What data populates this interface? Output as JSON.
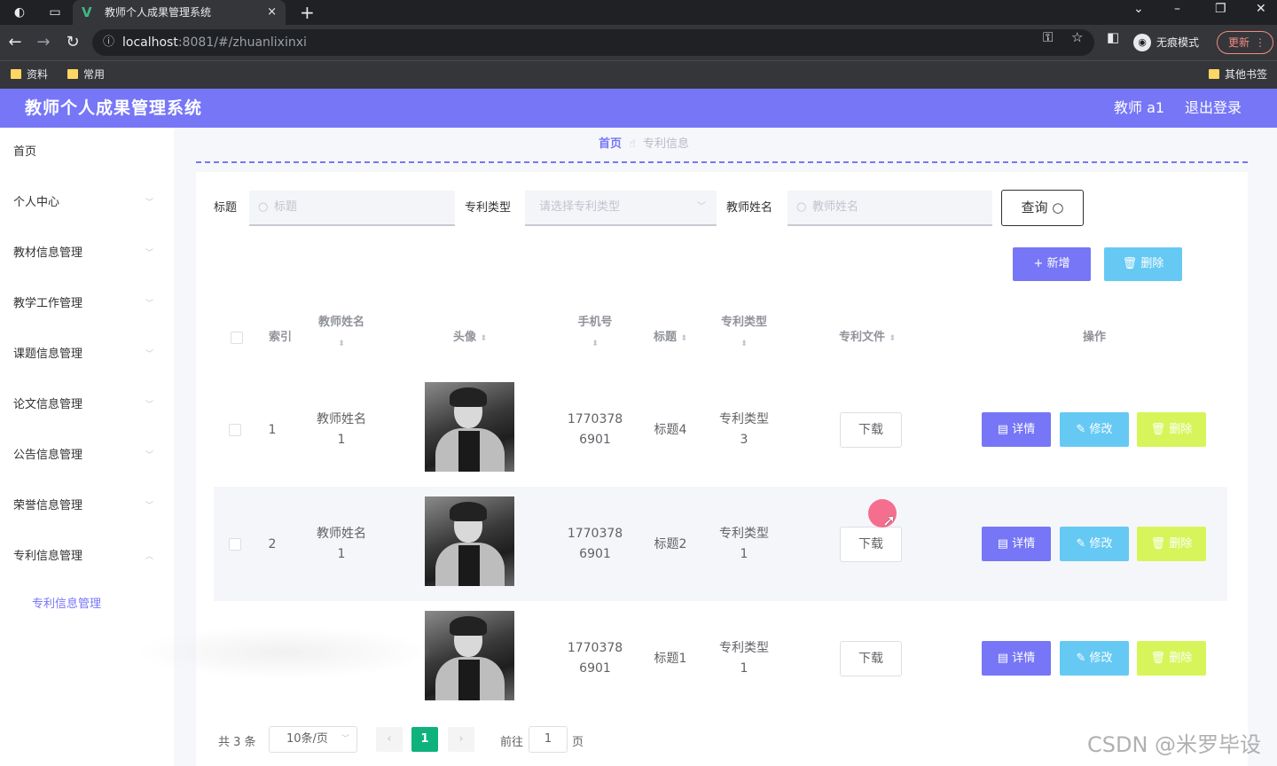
{
  "browser": {
    "tab_title": "教师个人成果管理系统",
    "tab_close": "×",
    "new_tab": "+",
    "url_host": "localhost",
    "url_path": ":8081/#/zhuanlixinxi",
    "incognito_label": "无痕模式",
    "update_label": "更新",
    "bookmarks": [
      "资料",
      "常用"
    ],
    "other_bookmarks": "其他书签"
  },
  "header": {
    "title": "教师个人成果管理系统",
    "user": "教师 a1",
    "logout": "退出登录"
  },
  "sidebar": {
    "items": [
      "首页",
      "个人中心",
      "教材信息管理",
      "教学工作管理",
      "课题信息管理",
      "论文信息管理",
      "公告信息管理",
      "荣誉信息管理",
      "专利信息管理"
    ],
    "sub_item": "专利信息管理"
  },
  "breadcrumb": {
    "home": "首页",
    "current": "专利信息"
  },
  "search": {
    "title_label": "标题",
    "title_placeholder": "标题",
    "type_label": "专利类型",
    "type_placeholder": "请选择专利类型",
    "teacher_label": "教师姓名",
    "teacher_placeholder": "教师姓名",
    "query_label": "查询"
  },
  "toolbar": {
    "add_label": "新增",
    "delete_label": "删除"
  },
  "table": {
    "headers": {
      "index": "索引",
      "teacher_name": "教师姓名",
      "avatar": "头像",
      "phone": "手机号",
      "title": "标题",
      "patent_type": "专利类型",
      "patent_file": "专利文件",
      "actions": "操作"
    },
    "rows": [
      {
        "index": "1",
        "name_a": "教师姓名",
        "name_b": "1",
        "phone_a": "1770378",
        "phone_b": "6901",
        "title": "标题4",
        "type_a": "专利类型",
        "type_b": "3"
      },
      {
        "index": "2",
        "name_a": "教师姓名",
        "name_b": "1",
        "phone_a": "1770378",
        "phone_b": "6901",
        "title": "标题2",
        "type_a": "专利类型",
        "type_b": "1"
      },
      {
        "index": "",
        "name_a": "",
        "name_b": "",
        "phone_a": "1770378",
        "phone_b": "6901",
        "title": "标题1",
        "type_a": "专利类型",
        "type_b": "1"
      }
    ],
    "download_label": "下载",
    "detail_label": "详情",
    "edit_label": "修改",
    "delete_label": "删除"
  },
  "pagination": {
    "total": "共 3 条",
    "page_size": "10条/页",
    "current_page": "1",
    "goto_prefix": "前往",
    "goto_value": "1",
    "goto_suffix": "页"
  },
  "watermark": "CSDN @米罗毕设",
  "colors": {
    "accent": "#7676f7",
    "info": "#66c9f4",
    "danger": "#d7f55a",
    "page_active": "#0fb27d"
  }
}
